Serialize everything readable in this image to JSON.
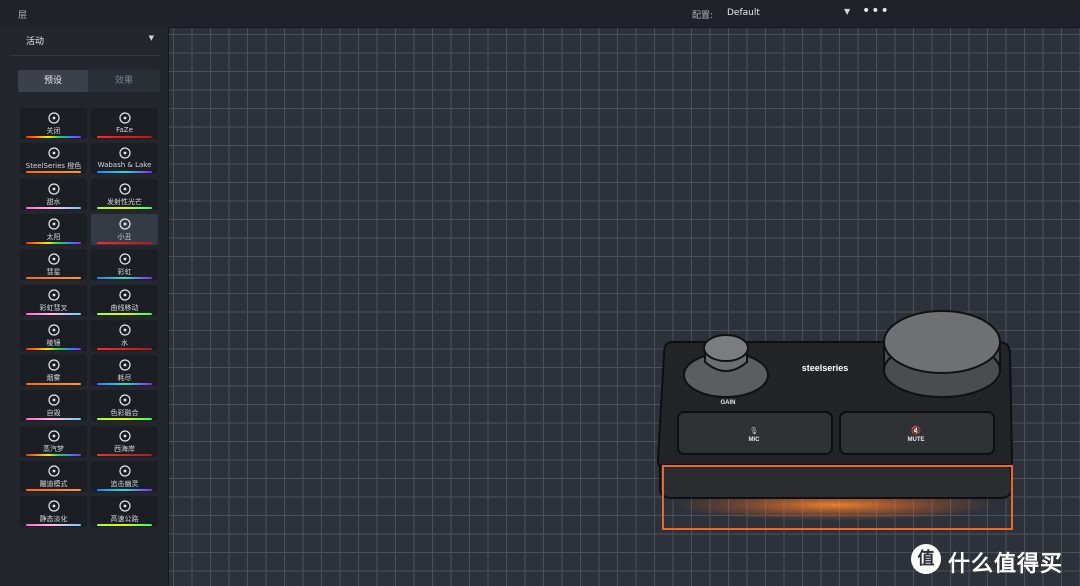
{
  "header": {
    "layer_title": "层",
    "profile_label": "配置:",
    "profile_value": "Default",
    "more_icon": "more-dots-icon"
  },
  "sidebar": {
    "layer_select": "活动",
    "tabs": [
      {
        "label": "预设",
        "active": true
      },
      {
        "label": "效果",
        "active": false
      }
    ],
    "presets": [
      {
        "label": "关闭",
        "icon": "off-icon"
      },
      {
        "label": "FaZe",
        "icon": "faze-logo-icon"
      },
      {
        "label": "SteelSeries 橙色",
        "icon": "steelseries-logo-icon"
      },
      {
        "label": "Wabash & Lake",
        "icon": "dots-grid-icon"
      },
      {
        "label": "甜水",
        "icon": "ice-cream-icon"
      },
      {
        "label": "发射性光芒",
        "icon": "radiation-icon"
      },
      {
        "label": "太阳",
        "icon": "sunrise-icon"
      },
      {
        "label": "小丑",
        "icon": "clown-icon",
        "selected": true
      },
      {
        "label": "彗星",
        "icon": "comet-icon"
      },
      {
        "label": "彩虹",
        "icon": "rainbow-icon"
      },
      {
        "label": "彩虹彗叉",
        "icon": "rainbow-cloud-icon"
      },
      {
        "label": "曲线移动",
        "icon": "broadcast-icon"
      },
      {
        "label": "棱镜",
        "icon": "diamond-icon"
      },
      {
        "label": "水",
        "icon": "water-waves-icon"
      },
      {
        "label": "烟雾",
        "icon": "smoke-icon"
      },
      {
        "label": "耗尽",
        "icon": "spiral-icon"
      },
      {
        "label": "自毁",
        "icon": "alarm-icon"
      },
      {
        "label": "色彩融合",
        "icon": "color-blend-icon"
      },
      {
        "label": "蒸汽梦",
        "icon": "vapor-icon"
      },
      {
        "label": "西海岸",
        "icon": "palm-tree-icon"
      },
      {
        "label": "蹦迪模式",
        "icon": "disco-ball-icon"
      },
      {
        "label": "追击幽灵",
        "icon": "ghost-icon"
      },
      {
        "label": "静态淡化",
        "icon": "lightning-icon"
      },
      {
        "label": "高速公路",
        "icon": "highway-icon"
      }
    ]
  },
  "device": {
    "brand": "steelseries",
    "gain_label": "GAIN",
    "mic_label": "MIC",
    "mute_label": "MUTE"
  },
  "watermark": {
    "symbol": "值",
    "text": "什么值得买"
  },
  "colors": {
    "accent_orange": "#e8692a",
    "canvas_bg": "#2d3139",
    "sidebar_bg": "#23272d"
  }
}
